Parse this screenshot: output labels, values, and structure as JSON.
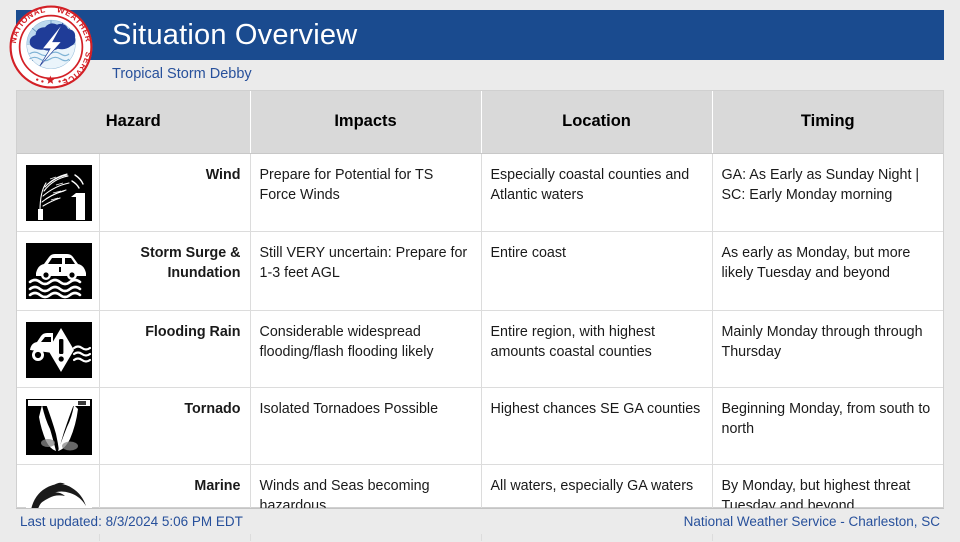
{
  "header": {
    "title": "Situation Overview",
    "subtitle": "Tropical Storm Debby",
    "logo_alt": "National Weather Service seal",
    "bar_color": "#1a4b8f",
    "title_color": "#ffffff",
    "subtitle_color": "#27509b"
  },
  "table": {
    "columns": [
      "Hazard",
      "Impacts",
      "Location",
      "Timing"
    ],
    "header_bg": "#d9d9d9",
    "rows": [
      {
        "icon": "wind-blown-tree-icon",
        "hazard": "Wind",
        "impacts": "Prepare for Potential for TS Force Winds",
        "location": "Especially coastal counties and Atlantic waters",
        "timing": "GA: As Early as Sunday Night |  SC: Early Monday morning"
      },
      {
        "icon": "car-in-floodwater-icon",
        "hazard": "Storm Surge & Inundation",
        "impacts": "Still VERY uncertain: Prepare for 1-3 feet AGL",
        "location": "Entire coast",
        "timing": "As early as Monday, but more likely Tuesday and beyond"
      },
      {
        "icon": "flooded-road-warning-icon",
        "hazard": "Flooding Rain",
        "impacts": "Considerable widespread flooding/flash flooding likely",
        "location": "Entire region, with highest amounts coastal counties",
        "timing": "Mainly Monday through through Thursday"
      },
      {
        "icon": "tornado-funnel-icon",
        "hazard": "Tornado",
        "impacts": "Isolated Tornadoes Possible",
        "location": "Highest chances SE GA counties",
        "timing": "Beginning Monday, from south to north"
      },
      {
        "icon": "ocean-wave-icon",
        "hazard": "Marine",
        "impacts": "Winds and Seas becoming hazardous",
        "location": "All waters, especially GA waters",
        "timing": "By Monday, but highest threat Tuesday and beyond"
      }
    ]
  },
  "footer": {
    "last_updated": "Last updated: 8/3/2024 5:06 PM EDT",
    "office": "National Weather Service - Charleston, SC",
    "text_color": "#27509b"
  }
}
